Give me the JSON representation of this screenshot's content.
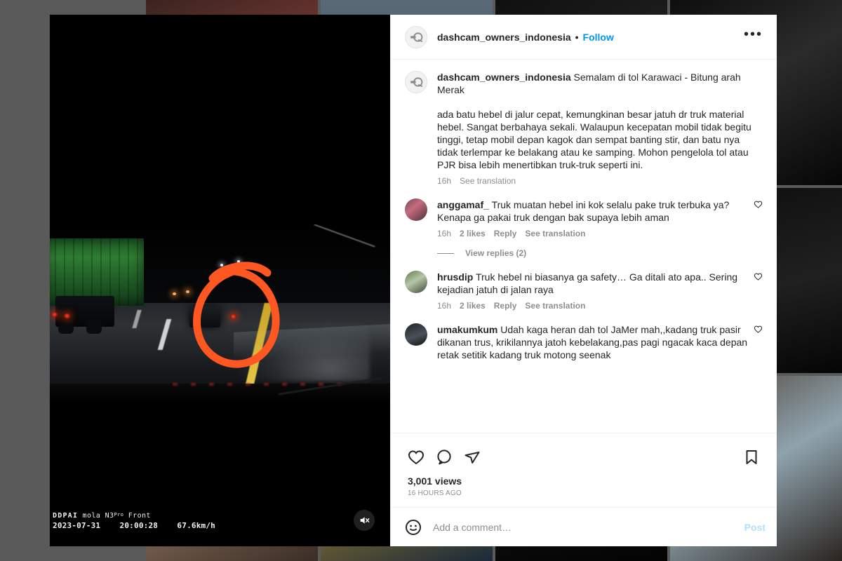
{
  "post": {
    "header": {
      "username": "dashcam_owners_indonesia",
      "separator": "•",
      "follow_label": "Follow",
      "more_options_label": "•••"
    },
    "caption": {
      "username": "dashcam_owners_indonesia",
      "line1": "Semalam di tol Karawaci - Bitung arah Merak",
      "body": "ada batu hebel di jalur cepat, kemungkinan besar jatuh dr truk material hebel. Sangat berbahaya sekali. Walaupun kecepatan mobil tidak begitu tinggi, tetap mobil depan kagok dan sempat banting stir, dan batu nya tidak terlempar ke belakang atau ke samping. Mohon pengelola tol atau PJR bisa lebih menertibkan truk-truk seperti ini.",
      "time": "16h",
      "see_translation": "See translation"
    },
    "comments": [
      {
        "username": "anggamaf_",
        "text": "Truk muatan hebel ini kok selalu pake truk terbuka ya? Kenapa ga pakai truk dengan bak supaya lebih aman",
        "time": "16h",
        "likes": "2 likes",
        "reply": "Reply",
        "see_translation": "See translation",
        "view_replies": "View replies (2)"
      },
      {
        "username": "hrusdip",
        "text": "Truk hebel ni biasanya ga safety… Ga ditali ato apa.. Sering kejadian jatuh di jalan raya",
        "time": "16h",
        "likes": "2 likes",
        "reply": "Reply",
        "see_translation": "See translation"
      },
      {
        "username": "umakumkum",
        "text": "Udah kaga heran dah tol JaMer mah,,kadang truk pasir dikanan trus, krikilannya jatoh kebelakang,pas pagi ngacak kaca depan retak setitik kadang truk motong seenak"
      }
    ],
    "actions": {
      "like_icon": "heart-icon",
      "comment_icon": "comment-bubble-icon",
      "share_icon": "share-paper-plane-icon",
      "save_icon": "bookmark-icon",
      "views": "3,001 views",
      "posted_time": "16 HOURS AGO"
    },
    "add_comment": {
      "emoji_icon": "emoji-smiley-icon",
      "placeholder": "Add a comment…",
      "post_label": "Post"
    }
  },
  "media": {
    "mute_icon": "speaker-muted-icon",
    "osd": {
      "brand": "DDPAI",
      "model": "mola N3",
      "model_suffix": "Pro",
      "channel": "Front",
      "date": "2023-07-31",
      "time": "20:00:28",
      "speed": "67.6km/h"
    },
    "annotation": {
      "type": "hand-drawn-circle",
      "color": "#FF5722"
    }
  },
  "colors": {
    "accent_link": "#0095f6",
    "text_primary": "#262626",
    "text_secondary": "#8e8e8e",
    "border": "#efefef",
    "post_disabled": "#b2dffc",
    "annotation_orange": "#FF5722",
    "backdrop": "#5a5a5a"
  }
}
